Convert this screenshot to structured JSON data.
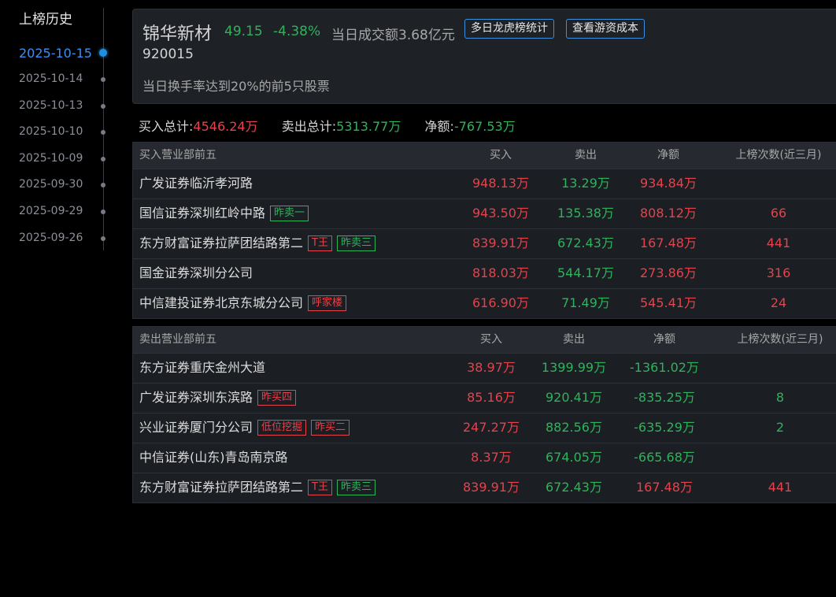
{
  "sidebar": {
    "title": "上榜历史",
    "dates": [
      "2025-10-15",
      "2025-10-14",
      "2025-10-13",
      "2025-10-10",
      "2025-10-09",
      "2025-09-30",
      "2025-09-29",
      "2025-09-26"
    ]
  },
  "header": {
    "name": "锦华新材",
    "price": "49.15",
    "change_pct": "-4.38%",
    "turnover": "当日成交额3.68亿元",
    "btn_multi_day": "多日龙虎榜统计",
    "btn_cost": "查看游资成本",
    "code": "920015",
    "description": "当日换手率达到20%的前5只股票"
  },
  "totals": {
    "buy_label": "买入总计:",
    "buy_value": "4546.24万",
    "sell_label": "卖出总计:",
    "sell_value": "5313.77万",
    "net_label": "净额:",
    "net_value": "-767.53万"
  },
  "buy_table": {
    "headers": [
      "买入营业部前五",
      "买入",
      "卖出",
      "净额",
      "上榜次数(近三月)"
    ],
    "rows": [
      {
        "name": "广发证券临沂孝河路",
        "tags": [],
        "buy": "948.13万",
        "sell": "13.29万",
        "net": "934.84万",
        "count": ""
      },
      {
        "name": "国信证券深圳红岭中路",
        "tags": [
          {
            "text": "昨卖一",
            "color": "green"
          }
        ],
        "buy": "943.50万",
        "sell": "135.38万",
        "net": "808.12万",
        "count": "66"
      },
      {
        "name": "东方财富证券拉萨团结路第二",
        "tags": [
          {
            "text": "T王",
            "color": "red"
          },
          {
            "text": "昨卖三",
            "color": "green"
          }
        ],
        "buy": "839.91万",
        "sell": "672.43万",
        "net": "167.48万",
        "count": "441"
      },
      {
        "name": "国金证券深圳分公司",
        "tags": [],
        "buy": "818.03万",
        "sell": "544.17万",
        "net": "273.86万",
        "count": "316"
      },
      {
        "name": "中信建投证券北京东城分公司",
        "tags": [
          {
            "text": "呼家楼",
            "color": "red"
          }
        ],
        "buy": "616.90万",
        "sell": "71.49万",
        "net": "545.41万",
        "count": "24"
      }
    ]
  },
  "sell_table": {
    "headers": [
      "卖出营业部前五",
      "买入",
      "卖出",
      "净额",
      "上榜次数(近三月)"
    ],
    "rows": [
      {
        "name": "东方证券重庆金州大道",
        "tags": [],
        "buy": "38.97万",
        "sell": "1399.99万",
        "net": "-1361.02万",
        "count": ""
      },
      {
        "name": "广发证券深圳东滨路",
        "tags": [
          {
            "text": "昨买四",
            "color": "red"
          }
        ],
        "buy": "85.16万",
        "sell": "920.41万",
        "net": "-835.25万",
        "count": "8"
      },
      {
        "name": "兴业证券厦门分公司",
        "tags": [
          {
            "text": "低位挖掘",
            "color": "red"
          },
          {
            "text": "昨买二",
            "color": "red"
          }
        ],
        "buy": "247.27万",
        "sell": "882.56万",
        "net": "-635.29万",
        "count": "2"
      },
      {
        "name": "中信证券(山东)青岛南京路",
        "tags": [],
        "buy": "8.37万",
        "sell": "674.05万",
        "net": "-665.68万",
        "count": ""
      },
      {
        "name": "东方财富证券拉萨团结路第二",
        "tags": [
          {
            "text": "T王",
            "color": "red"
          },
          {
            "text": "昨卖三",
            "color": "green"
          }
        ],
        "buy": "839.91万",
        "sell": "672.43万",
        "net": "167.48万",
        "count": "441"
      }
    ]
  },
  "colors": {
    "up": "#e5434b",
    "down": "#2fb35a",
    "accent": "#3b8fe0"
  }
}
